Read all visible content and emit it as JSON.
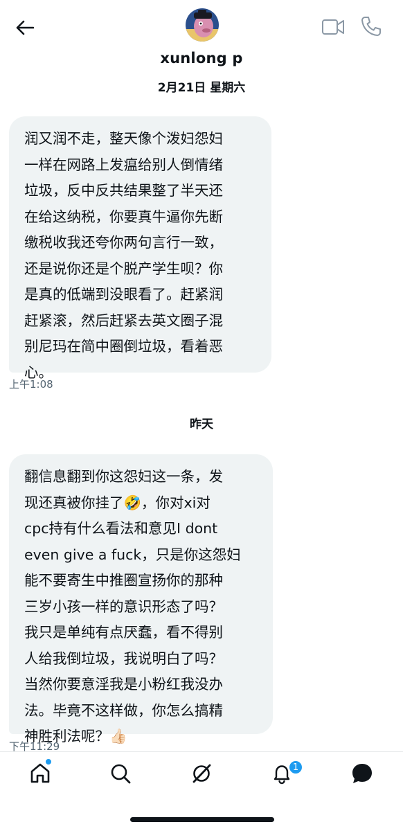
{
  "header": {
    "contact_name": "xunlong p",
    "date_label": "2月21日 星期六"
  },
  "icons": {
    "back": "arrow-left-icon",
    "video": "video-camera-icon",
    "phone": "phone-icon"
  },
  "messages": [
    {
      "text": "润又润不走，整天像个泼妇怨妇\n一样在网路上发瘟给别人倒情绪\n垃圾，反中反共结果整了半天还\n在给这纳税，你要真牛逼你先断\n缴税收我还夸你两句言行一致，\n还是说你还是个脱产学生呗？你\n是真的低端到没眼看了。赶紧润\n赶紧滚，然后赶紧去英文圈子混\n别尼玛在简中圈倒垃圾，看着恶\n心。",
      "time": "上午1:08"
    },
    {
      "text": "翻信息翻到你这怨妇这一条，发\n现还真被你挂了🤣，你对xi对\ncpc持有什么看法和意见I dont\neven give a fuck，只是你这怨妇\n能不要寄生中推圈宣扬你的那种\n三岁小孩一样的意识形态了吗？\n我只是单纯有点厌蠢，看不得别\n人给我倒垃圾，我说明白了吗？\n当然你要意淫我是小粉红我没办\n法。毕竟不这样做，你怎么搞精\n神胜利法呢？👍🏻",
      "time": "下午11:29"
    }
  ],
  "day_separator": "昨天",
  "tabbar": {
    "notifications_badge": "1",
    "accent_color": "#1d9bf0"
  }
}
